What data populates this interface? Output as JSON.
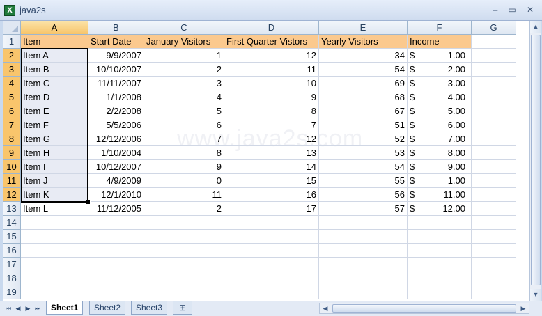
{
  "window": {
    "title": "java2s",
    "app_icon": "excel-icon",
    "minimize": "–",
    "maximize": "▭",
    "close": "✕"
  },
  "watermark": "www.java2s.com",
  "columns": [
    "A",
    "B",
    "C",
    "D",
    "E",
    "F",
    "G"
  ],
  "rows": [
    "1",
    "2",
    "3",
    "4",
    "5",
    "6",
    "7",
    "8",
    "9",
    "10",
    "11",
    "12",
    "13",
    "14",
    "15",
    "16",
    "17",
    "18",
    "19"
  ],
  "header": [
    "Item",
    "Start Date",
    "January Visitors",
    "First Quarter Vistors",
    "Yearly Visitors",
    "Income"
  ],
  "data": [
    [
      "Item A",
      "9/9/2007",
      "1",
      "12",
      "34",
      "1.00"
    ],
    [
      "Item B",
      "10/10/2007",
      "2",
      "11",
      "54",
      "2.00"
    ],
    [
      "Item C",
      "11/11/2007",
      "3",
      "10",
      "69",
      "3.00"
    ],
    [
      "Item D",
      "1/1/2008",
      "4",
      "9",
      "68",
      "4.00"
    ],
    [
      "Item E",
      "2/2/2008",
      "5",
      "8",
      "67",
      "5.00"
    ],
    [
      "Item F",
      "5/5/2006",
      "6",
      "7",
      "51",
      "6.00"
    ],
    [
      "Item G",
      "12/12/2006",
      "7",
      "12",
      "52",
      "7.00"
    ],
    [
      "Item H",
      "1/10/2004",
      "8",
      "13",
      "53",
      "8.00"
    ],
    [
      "Item I",
      "10/12/2007",
      "9",
      "14",
      "54",
      "9.00"
    ],
    [
      "Item J",
      "4/9/2009",
      "0",
      "15",
      "55",
      "1.00"
    ],
    [
      "Item K",
      "12/1/2010",
      "11",
      "16",
      "56",
      "11.00"
    ],
    [
      "Item L",
      "11/12/2005",
      "2",
      "17",
      "57",
      "12.00"
    ]
  ],
  "currency_symbol": "$",
  "sheets": [
    "Sheet1",
    "Sheet2",
    "Sheet3"
  ],
  "active_sheet": "Sheet1",
  "nav": [
    "⏮",
    "◀",
    "▶",
    "⏭"
  ],
  "colors": {
    "header_fill": "#fbc98e",
    "selection_header": "#f9c56c"
  }
}
